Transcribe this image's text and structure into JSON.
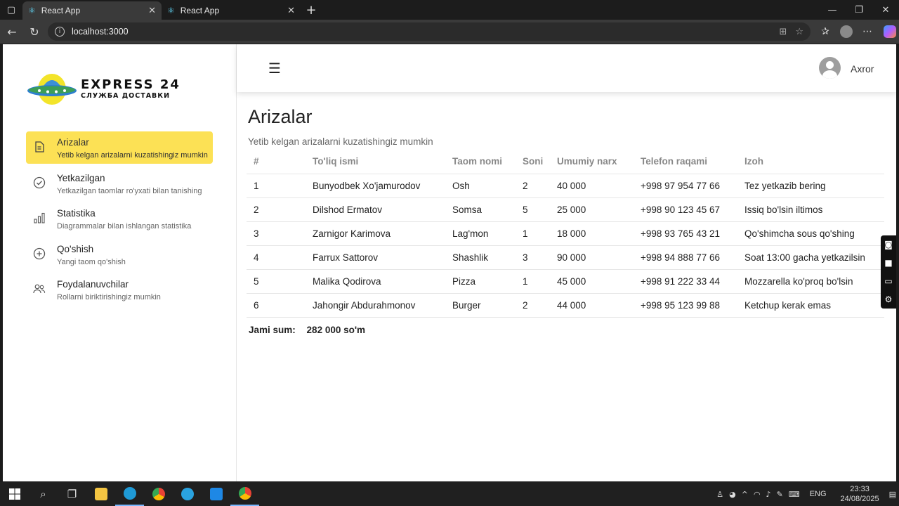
{
  "browser": {
    "tabs": [
      {
        "title": "React App"
      },
      {
        "title": "React App"
      }
    ],
    "url": "localhost:3000"
  },
  "logo": {
    "title": "EXPRESS 24",
    "subtitle": "СЛУЖБА ДОСТАВКИ"
  },
  "sidebar": {
    "items": [
      {
        "title": "Arizalar",
        "desc": "Yetib kelgan arizalarni kuzatishingiz mumkin",
        "icon": "document-icon"
      },
      {
        "title": "Yetkazilgan",
        "desc": "Yetkazilgan taomlar ro'yxati bilan tanishing",
        "icon": "check-circle-icon"
      },
      {
        "title": "Statistika",
        "desc": "Diagrammalar bilan ishlangan statistika",
        "icon": "bar-chart-icon"
      },
      {
        "title": "Qo'shish",
        "desc": "Yangi taom qo'shish",
        "icon": "plus-circle-icon"
      },
      {
        "title": "Foydalanuvchilar",
        "desc": "Rollarni biriktirishingiz mumkin",
        "icon": "users-icon"
      }
    ]
  },
  "header": {
    "username": "Axror"
  },
  "main": {
    "title": "Arizalar",
    "subtitle": "Yetib kelgan arizalarni kuzatishingiz mumkin",
    "columns": [
      "#",
      "To'liq ismi",
      "Taom nomi",
      "Soni",
      "Umumiy narx",
      "Telefon raqami",
      "Izoh"
    ],
    "rows": [
      [
        "1",
        "Bunyodbek Xo'jamurodov",
        "Osh",
        "2",
        "40 000",
        "+998 97 954 77 66",
        "Tez yetkazib bering"
      ],
      [
        "2",
        "Dilshod Ermatov",
        "Somsa",
        "5",
        "25 000",
        "+998 90 123 45 67",
        "Issiq bo'lsin iltimos"
      ],
      [
        "3",
        "Zarnigor Karimova",
        "Lag'mon",
        "1",
        "18 000",
        "+998 93 765 43 21",
        "Qo'shimcha sous qo'shing"
      ],
      [
        "4",
        "Farrux Sattorov",
        "Shashlik",
        "3",
        "90 000",
        "+998 94 888 77 66",
        "Soat 13:00 gacha yetkazilsin"
      ],
      [
        "5",
        "Malika Qodirova",
        "Pizza",
        "1",
        "45 000",
        "+998 91 222 33 44",
        "Mozzarella ko'proq bo'lsin"
      ],
      [
        "6",
        "Jahongir Abdurahmonov",
        "Burger",
        "2",
        "44 000",
        "+998 95 123 99 88",
        "Ketchup kerak emas"
      ]
    ],
    "total_label": "Jami sum:",
    "total_value": "282 000 so'm"
  },
  "taskbar": {
    "language": "ENG",
    "time": "23:33",
    "date": "24/08/2025"
  }
}
